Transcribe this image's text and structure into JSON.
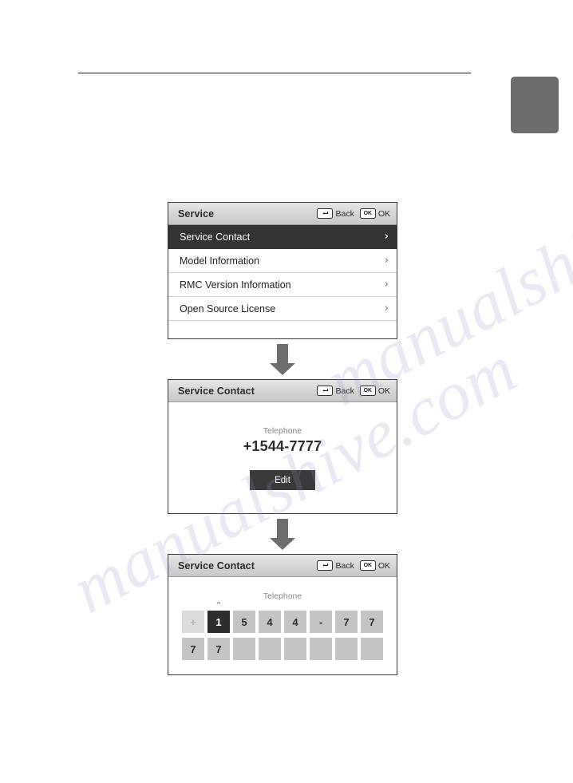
{
  "page": {
    "rule_present": true,
    "tab_color": "#6d6d6d",
    "watermark_text": "manualshive.com"
  },
  "icons": {
    "back_key": "back-return-key-icon",
    "ok_key": "ok-key-icon",
    "chevron_right": "›",
    "caret_up": "⌃",
    "caret_down": "⌄",
    "arrow_down": "arrow-down-icon"
  },
  "header_actions": {
    "back_key_label": "",
    "back_label": "Back",
    "ok_key_label": "OK",
    "ok_label": "OK"
  },
  "screens": [
    {
      "id": "service-menu",
      "title": "Service",
      "rows": [
        {
          "label": "Service Contact",
          "selected": true
        },
        {
          "label": "Model Information",
          "selected": false
        },
        {
          "label": "RMC Version Information",
          "selected": false
        },
        {
          "label": "Open Source License",
          "selected": false
        }
      ]
    },
    {
      "id": "service-contact-view",
      "title": "Service Contact",
      "field_label": "Telephone",
      "field_value": "+1544-7777",
      "edit_button_label": "Edit"
    },
    {
      "id": "service-contact-edit",
      "title": "Service Contact",
      "field_label": "Telephone",
      "digits_row1": [
        {
          "char": "+",
          "state": "dim"
        },
        {
          "char": "1",
          "state": "active"
        },
        {
          "char": "5",
          "state": "normal"
        },
        {
          "char": "4",
          "state": "normal"
        },
        {
          "char": "4",
          "state": "normal"
        },
        {
          "char": "-",
          "state": "normal"
        },
        {
          "char": "7",
          "state": "normal"
        },
        {
          "char": "7",
          "state": "normal"
        }
      ],
      "digits_row2": [
        {
          "char": "7",
          "state": "normal"
        },
        {
          "char": "7",
          "state": "normal"
        },
        {
          "char": "",
          "state": "blank"
        },
        {
          "char": "",
          "state": "blank"
        },
        {
          "char": "",
          "state": "blank"
        },
        {
          "char": "",
          "state": "blank"
        },
        {
          "char": "",
          "state": "blank"
        },
        {
          "char": "",
          "state": "blank"
        }
      ]
    }
  ],
  "colors": {
    "selected_row": "#333333",
    "header_gray": "#d5d5d5",
    "cell_gray": "#c4c4c4",
    "accent_dark": "#2e2e2e"
  }
}
